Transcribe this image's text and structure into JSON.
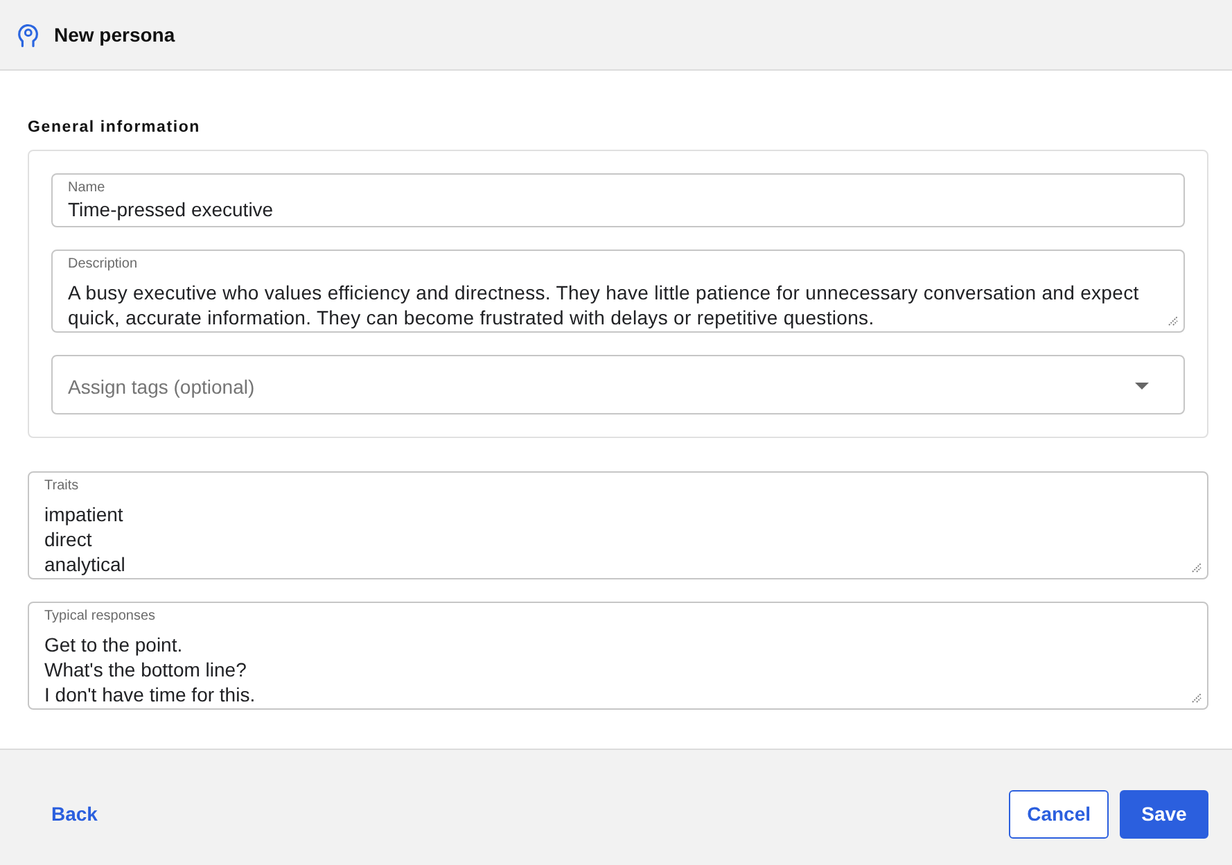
{
  "header": {
    "title": "New persona"
  },
  "general_information": {
    "heading": "General information",
    "name": {
      "label": "Name",
      "value": "Time-pressed executive"
    },
    "description": {
      "label": "Description",
      "value": "A busy executive who values efficiency and directness. They have little patience for unnecessary conversation and expect quick, accurate information. They can become frustrated with delays or repetitive questions."
    },
    "tags": {
      "placeholder": "Assign tags (optional)"
    }
  },
  "traits": {
    "label": "Traits",
    "lines": [
      "impatient",
      "direct",
      "analytical"
    ]
  },
  "typical_responses": {
    "label": "Typical responses",
    "lines": [
      "Get to the point.",
      "What's the bottom line?",
      "I don't have time for this."
    ]
  },
  "footer": {
    "back": "Back",
    "buttons": [
      {
        "label": "Cancel",
        "kind": "secondary"
      },
      {
        "label": "Save",
        "kind": "primary"
      }
    ]
  }
}
